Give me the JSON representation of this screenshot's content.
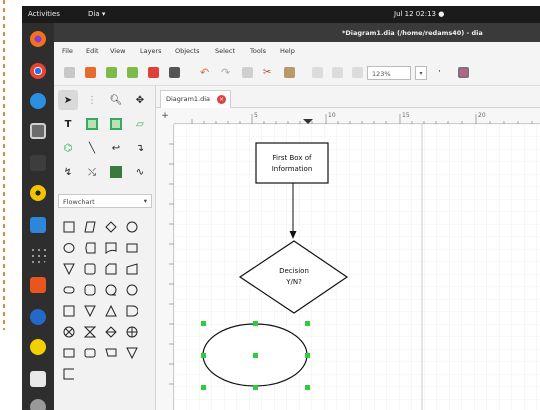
{
  "topbar": {
    "activities": "Activities",
    "app_name": "Dia",
    "clock": "Jul 12  02:13"
  },
  "window": {
    "title": "*Diagram1.dia (/home/redams40) - dia"
  },
  "menu": [
    "File",
    "Edit",
    "View",
    "Layers",
    "Objects",
    "Select",
    "Tools",
    "Help"
  ],
  "toolbar": {
    "zoom": "123%"
  },
  "toolbox": {
    "sheet": "Flowchart"
  },
  "tab": {
    "label": "Diagram1.dia"
  },
  "ruler": {
    "marks": [
      "5",
      "10",
      "15",
      "20"
    ]
  },
  "diagram": {
    "process_box": {
      "line1": "First Box of",
      "line2": "Information"
    },
    "decision": {
      "line1": "Decision",
      "line2": "Y/N?"
    }
  },
  "colors": {
    "topbar": "#1b1b1b",
    "dock": "#2e2e2e",
    "titlebar": "#3a3a3a",
    "handle": "#2ecc40",
    "tab_close": "#e04040"
  }
}
